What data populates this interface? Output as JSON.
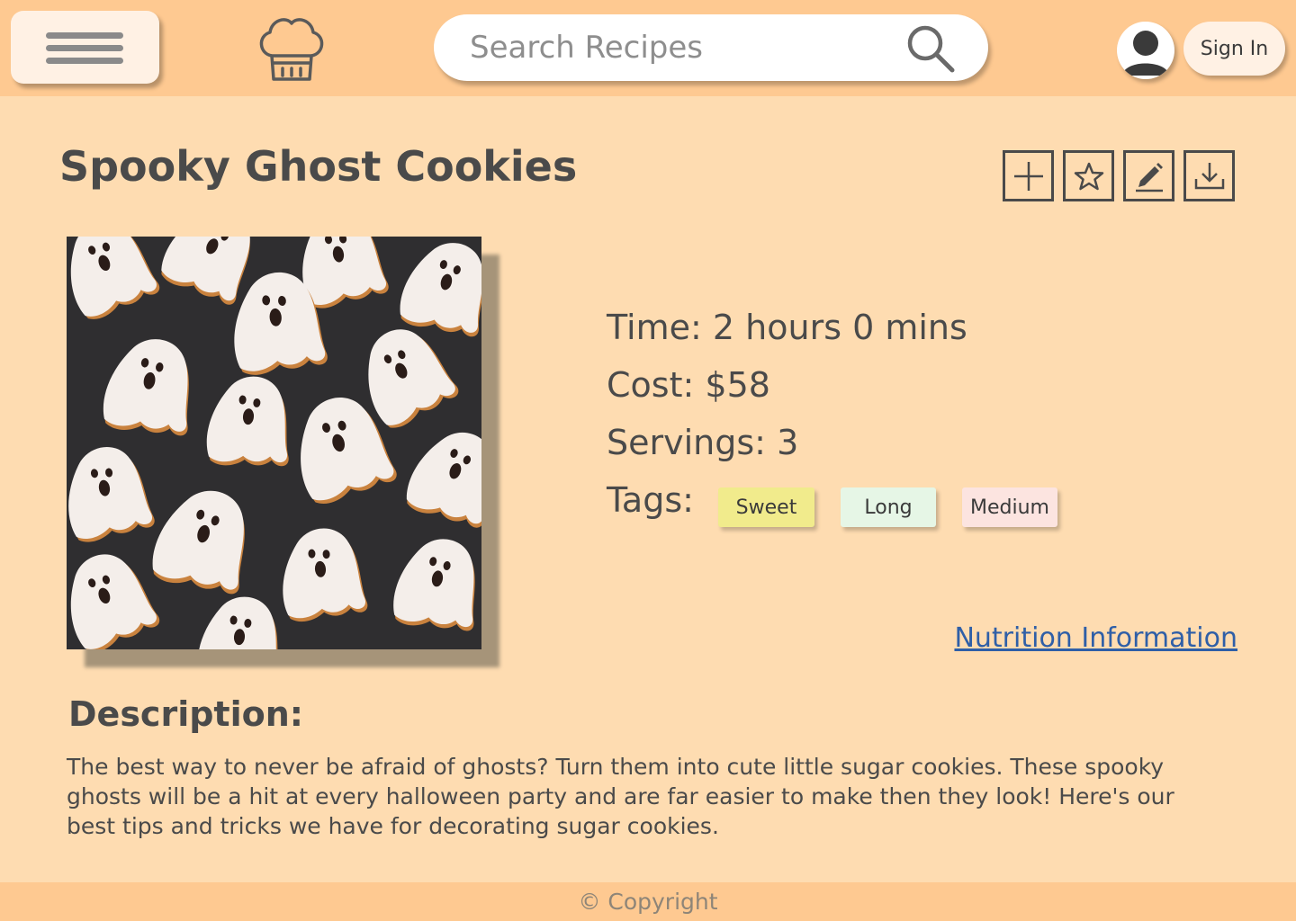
{
  "header": {
    "search": {
      "placeholder": "Search Recipes"
    },
    "signin_label": "Sign In"
  },
  "recipe": {
    "title": "Spooky Ghost Cookies",
    "time_label": "Time:",
    "time_value": "2 hours 0 mins",
    "cost_label": "Cost:",
    "cost_value": "$58",
    "servings_label": "Servings:",
    "servings_value": "3",
    "tags_label": "Tags:",
    "tags": [
      {
        "label": "Sweet",
        "color": "#f1eb8c"
      },
      {
        "label": "Long",
        "color": "#e6f6e6"
      },
      {
        "label": "Medium",
        "color": "#fce4e0"
      }
    ],
    "nutrition_link": "Nutrition Information",
    "description_heading": "Description:",
    "description": "The best way to never be afraid of ghosts? Turn them into cute little sugar cookies. These spooky ghosts will be a hit at every halloween party and are far easier to make then they look! Here's our best tips and tricks we have for decorating sugar cookies."
  },
  "toolbar": {
    "icons": [
      "plus-icon",
      "star-icon",
      "pencil-icon",
      "download-icon"
    ]
  },
  "footer": {
    "copyright": "© Copyright"
  },
  "colors": {
    "header_bg": "#fec991",
    "page_bg": "#fedcb1",
    "link": "#2f5fa7",
    "text": "#4a4a4a"
  }
}
